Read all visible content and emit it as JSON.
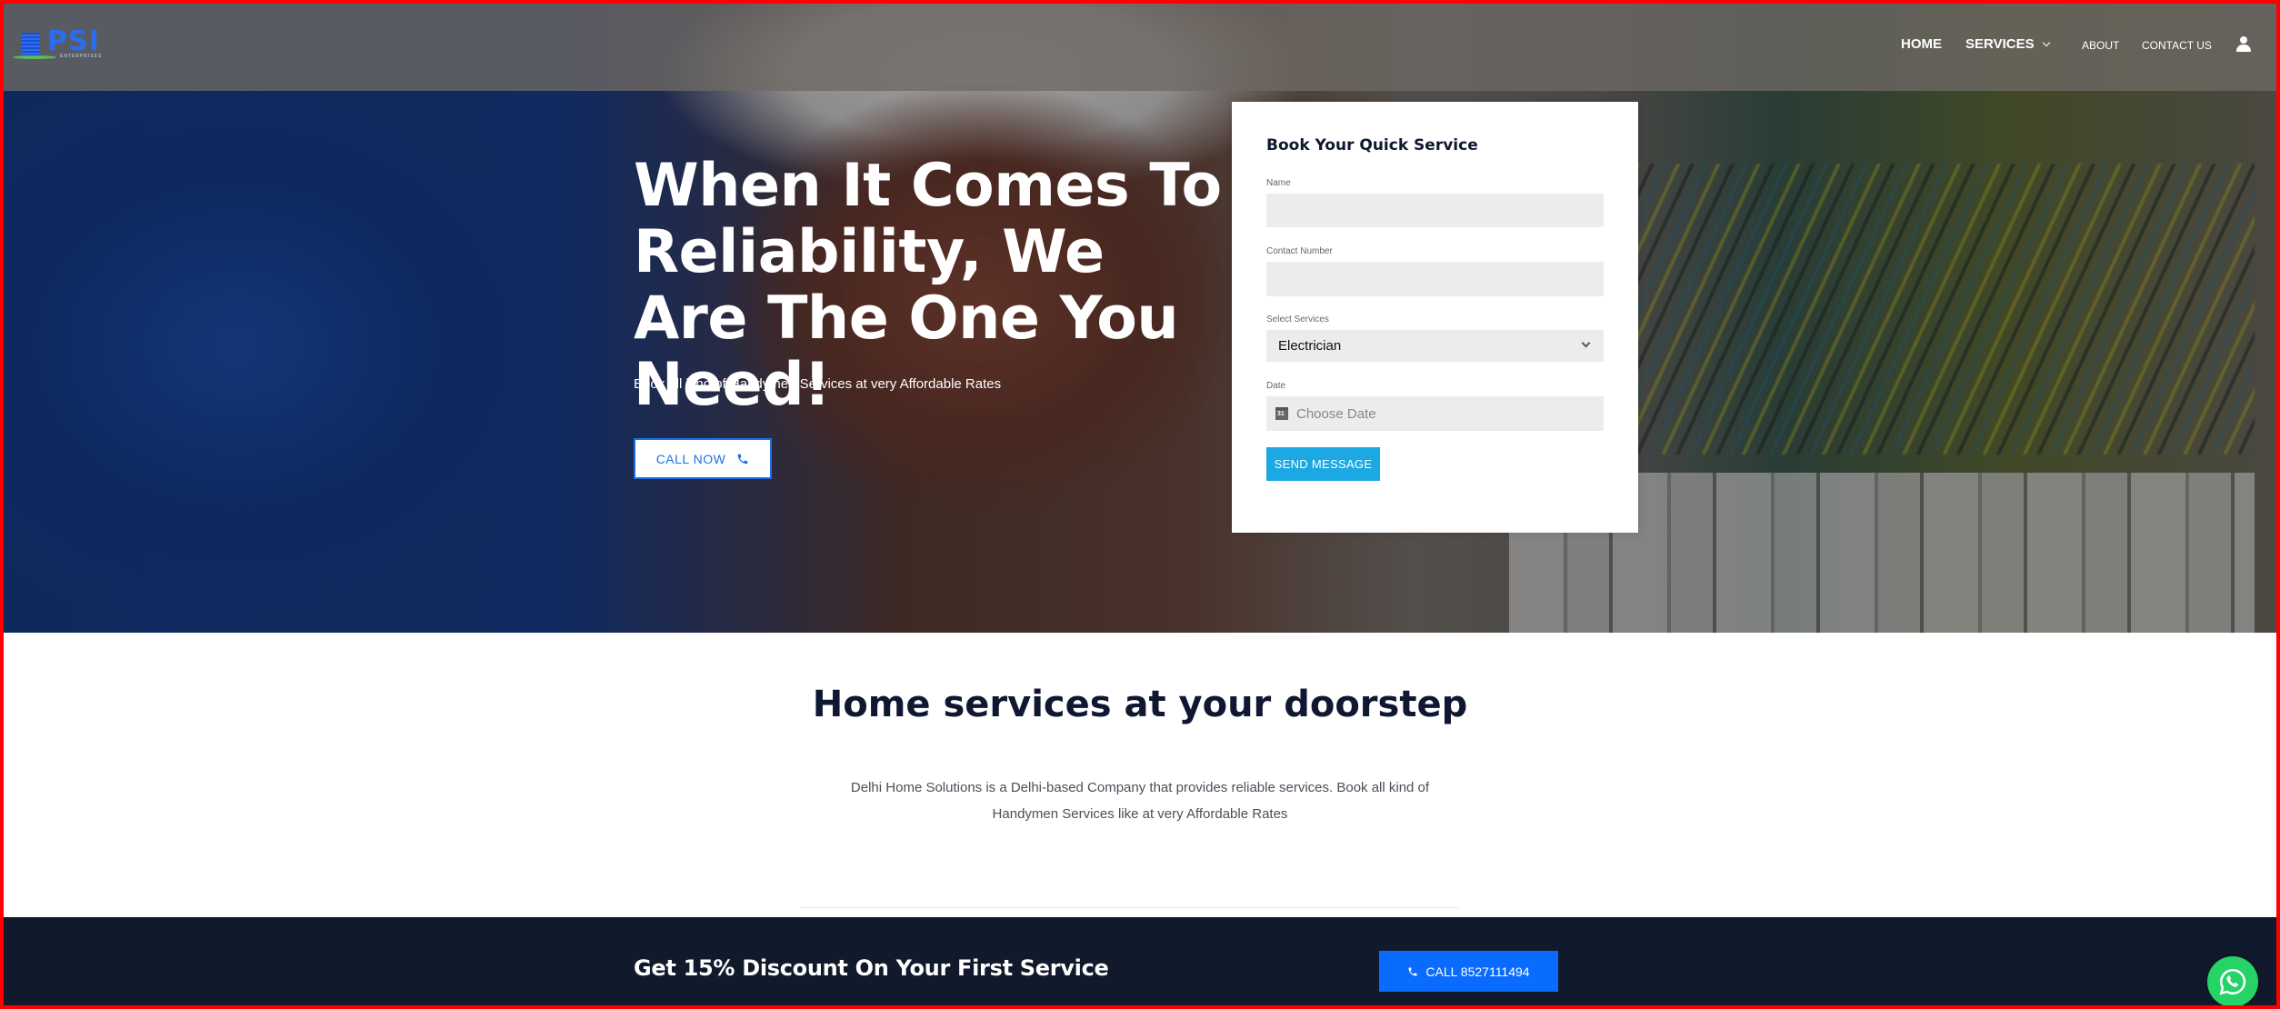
{
  "header": {
    "logo": {
      "text": "PSI",
      "subtext": "ENTERPRISES"
    },
    "nav": [
      {
        "label": "HOME"
      },
      {
        "label": "SERVICES"
      },
      {
        "label": "ABOUT"
      },
      {
        "label": "CONTACT US"
      }
    ],
    "user_icon": "user-icon"
  },
  "hero": {
    "title": "When It Comes To Reliability, We Are The One You Need!",
    "subtitle": "Book all kind of Handymen Services at very Affordable Rates",
    "call_button": {
      "label": "CALL NOW",
      "icon": "phone-icon"
    }
  },
  "booking_form": {
    "title": "Book Your Quick Service",
    "fields": {
      "name": {
        "label": "Name",
        "value": ""
      },
      "contact": {
        "label": "Contact Number",
        "value": ""
      },
      "service": {
        "label": "Select Services",
        "selected": "Electrician"
      },
      "date": {
        "label": "Date",
        "placeholder": "Choose Date",
        "icon": "calendar-icon"
      }
    },
    "submit_label": "SEND MESSAGE"
  },
  "about": {
    "title": "Home services at your doorstep",
    "text": "Delhi Home Solutions is a Delhi-based Company that provides reliable services. Book all kind of Handymen Services like at very Affordable Rates"
  },
  "promo": {
    "text": "Get 15% Discount On Your First Service",
    "button_label": "CALL 8527111494",
    "button_icon": "phone-icon"
  },
  "floating": {
    "whatsapp_icon": "whatsapp-icon"
  },
  "colors": {
    "accent_blue": "#0a6cff",
    "send_button": "#1ba8e3",
    "promo_bg": "#111a2c",
    "whatsapp": "#25d366",
    "heading": "#0f1830"
  }
}
